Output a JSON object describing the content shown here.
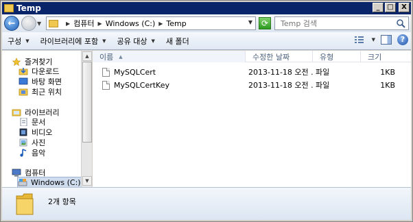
{
  "window": {
    "title": "Temp"
  },
  "title_buttons": {
    "minimize": "_",
    "maximize": "□",
    "close": "X"
  },
  "address": {
    "crumbs": [
      "컴퓨터",
      "Windows (C:)",
      "Temp"
    ]
  },
  "search": {
    "placeholder": "Temp 검색"
  },
  "toolbar": {
    "organize": "구성",
    "include_library": "라이브러리에 포함",
    "share_with": "공유 대상",
    "new_folder": "새 폴더"
  },
  "nav": {
    "favorites": "즐겨찾기",
    "downloads": "다운로드",
    "desktop": "바탕 화면",
    "recent": "최근 위치",
    "libraries": "라이브러리",
    "documents": "문서",
    "videos": "비디오",
    "pictures": "사진",
    "music": "음악",
    "computer": "컴퓨터",
    "windows_c": "Windows (C:)"
  },
  "columns": {
    "name": "이름",
    "date": "수정한 날짜",
    "type": "유형",
    "size": "크기"
  },
  "files": [
    {
      "name": "MySQLCert",
      "date": "2013-11-18 오전 ...",
      "type": "파일",
      "size": "1KB"
    },
    {
      "name": "MySQLCertKey",
      "date": "2013-11-18 오전 ...",
      "type": "파일",
      "size": "1KB"
    }
  ],
  "status": {
    "item_count": "2개 항목"
  },
  "colors": {
    "title_bar": "#0a246a",
    "selection": "#cfdcee",
    "folder": "#f0c850"
  }
}
